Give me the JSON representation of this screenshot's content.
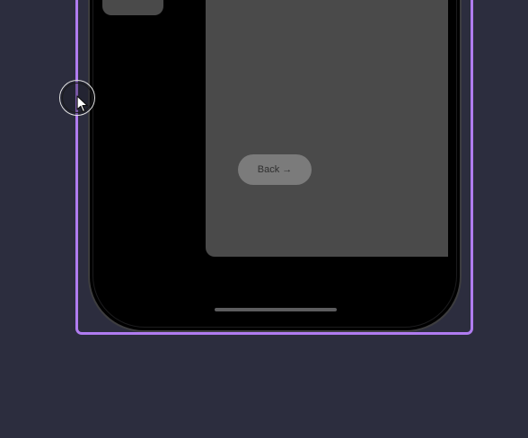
{
  "colors": {
    "background": "#2c2d3e",
    "selection_frame": "#b07cf0",
    "phone_body": "#000000",
    "card": "#4a4a4a",
    "button": "#7b7b7b"
  },
  "main": {
    "back_button": {
      "label": "Back",
      "icon": "arrow-right-icon",
      "icon_glyph": "→"
    }
  },
  "icons": {
    "cursor": "pointer-cursor-icon"
  }
}
